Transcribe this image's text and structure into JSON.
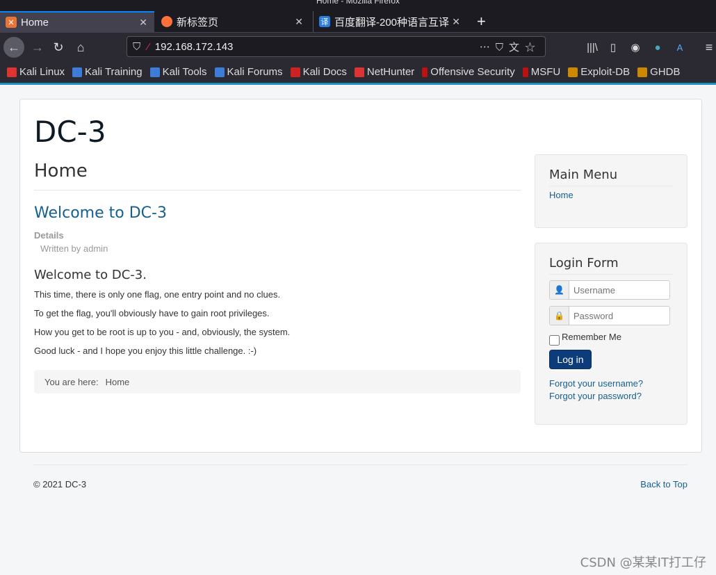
{
  "window": {
    "title": "Home - Mozilla Firefox"
  },
  "tabs": [
    {
      "label": "Home",
      "active": true
    },
    {
      "label": "新标签页"
    },
    {
      "label": "百度翻译-200种语言互译"
    }
  ],
  "urlbar": {
    "url": "192.168.172.143"
  },
  "bookmarks": [
    "Kali Linux",
    "Kali Training",
    "Kali Tools",
    "Kali Forums",
    "Kali Docs",
    "NetHunter",
    "Offensive Security",
    "MSFU",
    "Exploit-DB",
    "GHDB"
  ],
  "site": {
    "brand": "DC-3",
    "page_title": "Home",
    "article": {
      "title": "Welcome to DC-3",
      "details_label": "Details",
      "written_by": "Written by admin",
      "heading": "Welcome to DC-3.",
      "paragraphs": [
        "This time, there is only one flag, one entry point and no clues.",
        "To get the flag, you'll obviously have to gain root privileges.",
        "How you get to be root is up to you - and, obviously, the system.",
        "Good luck - and I hope you enjoy this little challenge.  :-)"
      ]
    },
    "breadcrumb": {
      "label": "You are here:",
      "current": "Home"
    },
    "main_menu": {
      "title": "Main Menu",
      "items": [
        "Home"
      ]
    },
    "login": {
      "title": "Login Form",
      "username_placeholder": "Username",
      "password_placeholder": "Password",
      "remember": "Remember Me",
      "submit": "Log in",
      "forgot_username": "Forgot your username?",
      "forgot_password": "Forgot your password?"
    },
    "footer": {
      "copyright": "© 2021 DC-3",
      "back_to_top": "Back to Top"
    }
  },
  "watermark": "CSDN @某某IT打工仔"
}
